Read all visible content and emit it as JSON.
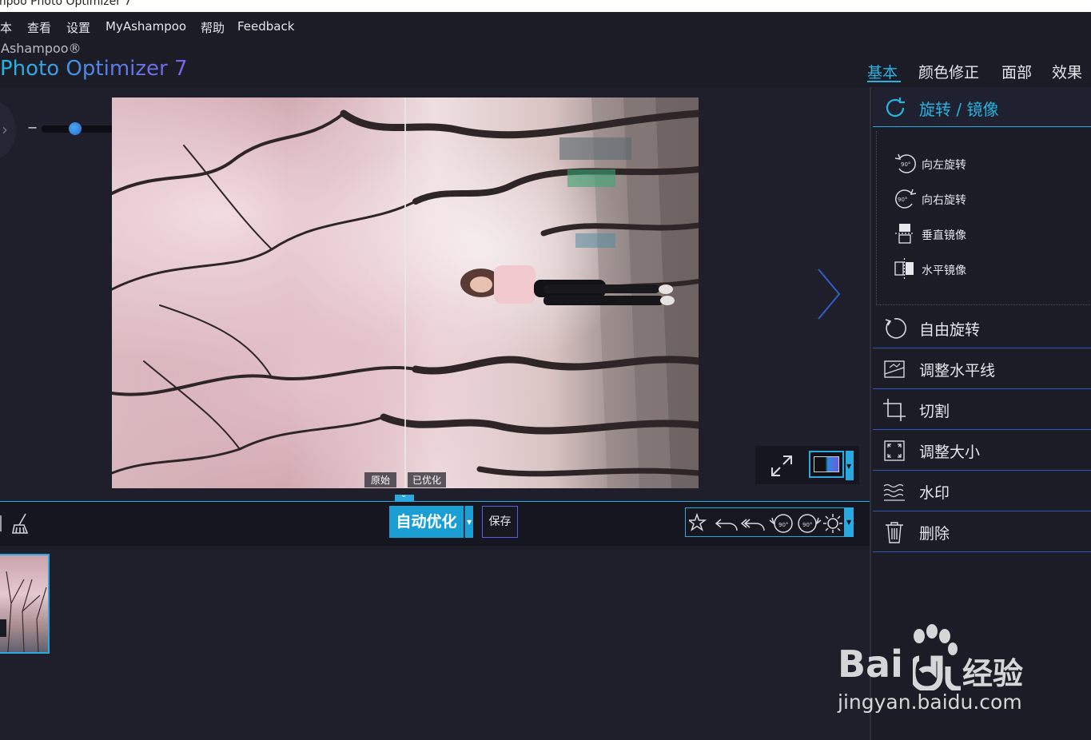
{
  "window": {
    "title": "mpoo Photo Optimizer 7"
  },
  "menu": {
    "items": [
      "本",
      "查看",
      "设置",
      "MyAshampoo",
      "帮助",
      "Feedback"
    ]
  },
  "brand": {
    "company": "Ashampoo®",
    "product": "Photo Optimizer 7"
  },
  "tabs": [
    {
      "label": "基本",
      "active": true
    },
    {
      "label": "颜色修正",
      "active": false
    },
    {
      "label": "面部",
      "active": false
    },
    {
      "label": "效果",
      "active": false
    }
  ],
  "viewer": {
    "zoom_minus": "−",
    "zoom_plus": "+",
    "label_original": "原始",
    "label_optimized": "已优化"
  },
  "toolbar": {
    "auto_optimize": "自动优化",
    "save": "保存"
  },
  "panel": {
    "section_title": "旋转 / 镜像",
    "sub_items": [
      {
        "label": "向左旋转",
        "icon": "rotate-left-90-icon"
      },
      {
        "label": "向右旋转",
        "icon": "rotate-right-90-icon"
      },
      {
        "label": "垂直镜像",
        "icon": "mirror-vertical-icon"
      },
      {
        "label": "水平镜像",
        "icon": "mirror-horizontal-icon"
      }
    ],
    "rows": [
      {
        "label": "自由旋转",
        "icon": "free-rotate-icon"
      },
      {
        "label": "调整水平线",
        "icon": "straighten-horizon-icon"
      },
      {
        "label": "切割",
        "icon": "crop-icon"
      },
      {
        "label": "调整大小",
        "icon": "resize-icon"
      },
      {
        "label": "水印",
        "icon": "watermark-icon"
      },
      {
        "label": "删除",
        "icon": "trash-icon"
      }
    ]
  },
  "watermark": {
    "brand_latin": "Bai",
    "brand_cn": "经验",
    "url": "jingyan.baidu.com"
  },
  "colors": {
    "accent": "#27b4e0",
    "background": "#1e1f2a",
    "panel": "#1b1c26",
    "auto_button": "#1a9ed4"
  }
}
